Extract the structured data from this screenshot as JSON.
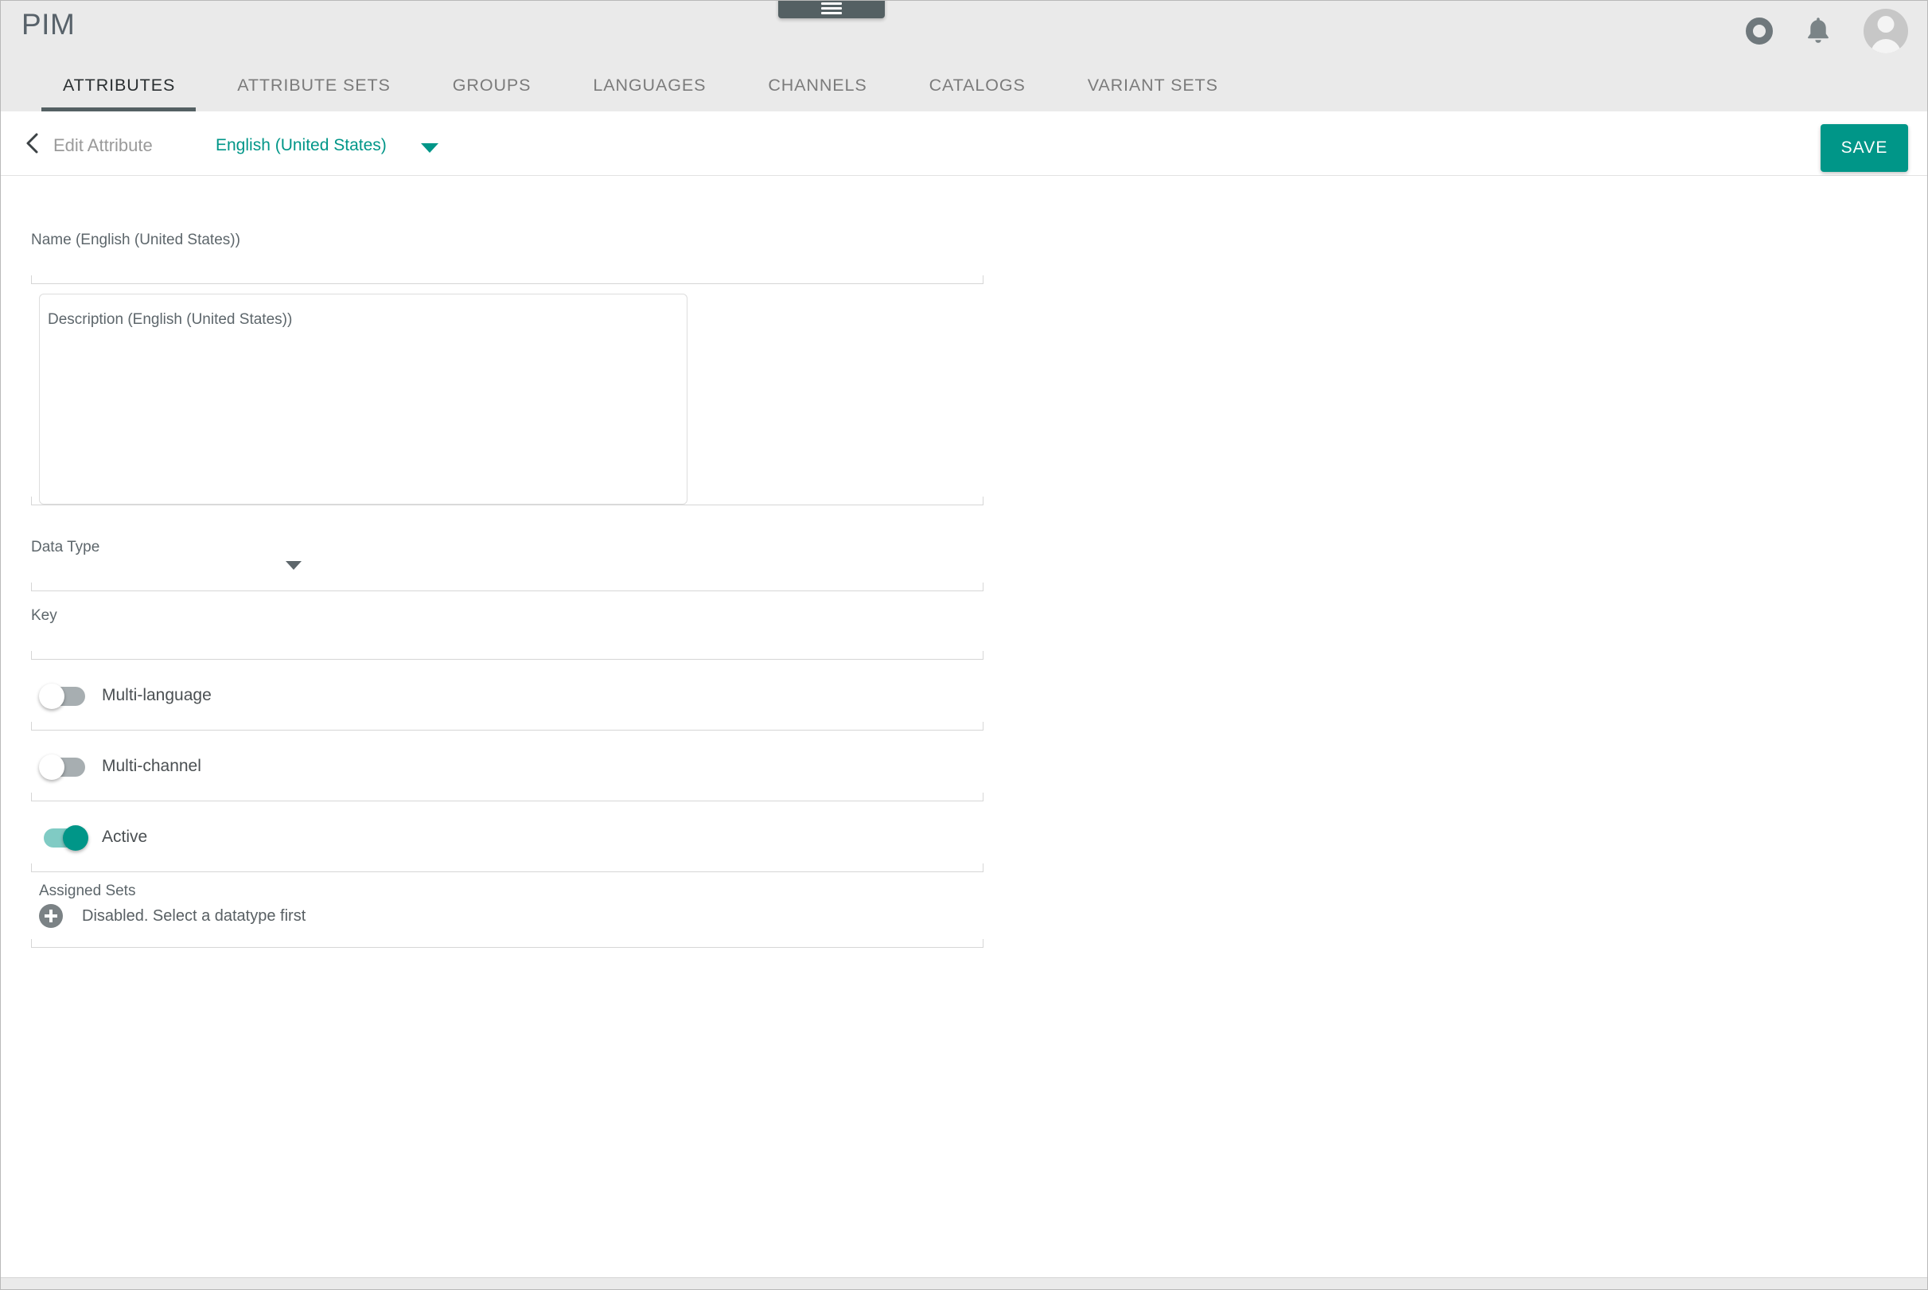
{
  "header": {
    "brand": "PIM",
    "menu_icon": "hamburger-icon",
    "actions": [
      {
        "icon": "ring-status-icon",
        "label": ""
      },
      {
        "icon": "bell-notifications-icon",
        "label": ""
      },
      {
        "icon": "user-avatar-icon",
        "label": ""
      }
    ],
    "tabs": [
      {
        "label": "ATTRIBUTES",
        "active": true
      },
      {
        "label": "ATTRIBUTE SETS",
        "active": false
      },
      {
        "label": "GROUPS",
        "active": false
      },
      {
        "label": "LANGUAGES",
        "active": false
      },
      {
        "label": "CHANNELS",
        "active": false
      },
      {
        "label": "CATALOGS",
        "active": false
      },
      {
        "label": "VARIANT SETS",
        "active": false
      }
    ]
  },
  "subheader": {
    "back_icon": "chevron-left-icon",
    "title": "Edit Attribute",
    "language": "English (United States)",
    "language_caret_icon": "caret-down-icon",
    "save_label": "SAVE"
  },
  "form": {
    "name": {
      "label": "Name (English (United States))",
      "value": ""
    },
    "description": {
      "label": "Description (English (United States))",
      "value": ""
    },
    "data_type": {
      "label": "Data Type",
      "value": "",
      "caret_icon": "caret-down-icon"
    },
    "key": {
      "label": "Key",
      "value": ""
    },
    "toggles": [
      {
        "label": "Multi-language",
        "on": false
      },
      {
        "label": "Multi-channel",
        "on": false
      },
      {
        "label": "Active",
        "on": true
      }
    ],
    "assigned_sets": {
      "label": "Assigned Sets",
      "add_icon": "plus-circle-icon",
      "message": "Disabled. Select a datatype first"
    }
  },
  "colors": {
    "accent": "#009688",
    "header_bg": "#eaeaea",
    "tab_indicator": "#546063",
    "toggle_off_track": "#a7aeb1",
    "toggle_on_track": "#80cbc4"
  }
}
